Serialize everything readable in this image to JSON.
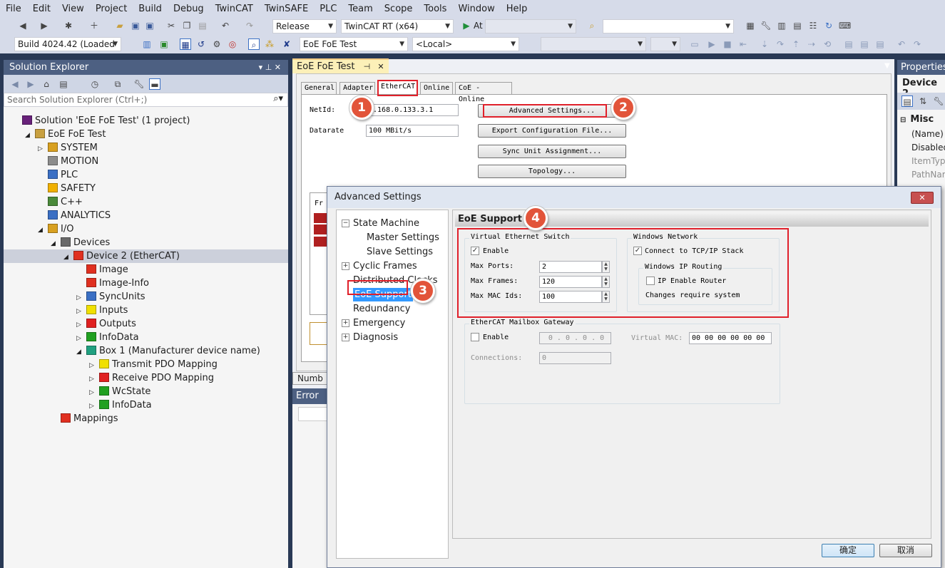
{
  "menu": [
    "File",
    "Edit",
    "View",
    "Project",
    "Build",
    "Debug",
    "TwinCAT",
    "TwinSAFE",
    "PLC",
    "Team",
    "Scope",
    "Tools",
    "Window",
    "Help"
  ],
  "toolbar1": {
    "config": "Release",
    "platform": "TwinCAT RT (x64)",
    "attach": "At"
  },
  "toolbar2": {
    "build": "Build 4024.42 (Loaded",
    "project": "EoE FoE Test",
    "target": "<Local>"
  },
  "solution_explorer": {
    "title": "Solution Explorer",
    "search_placeholder": "Search Solution Explorer (Ctrl+;)",
    "items": [
      {
        "label": "Solution 'EoE FoE Test' (1 project)",
        "color": "#68217a"
      },
      {
        "label": "EoE FoE Test",
        "color": "#c8a040"
      },
      {
        "label": "SYSTEM",
        "color": "#d8a020"
      },
      {
        "label": "MOTION",
        "color": "#8c8c8c"
      },
      {
        "label": "PLC",
        "color": "#3a6fc4"
      },
      {
        "label": "SAFETY",
        "color": "#f0b000"
      },
      {
        "label": "C++",
        "color": "#4a8a3a"
      },
      {
        "label": "ANALYTICS",
        "color": "#3a6fc4"
      },
      {
        "label": "I/O",
        "color": "#d8a020"
      },
      {
        "label": "Devices",
        "color": "#6a6a6a"
      },
      {
        "label": "Device 2 (EtherCAT)",
        "color": "#e03020"
      },
      {
        "label": "Image",
        "color": "#e03020"
      },
      {
        "label": "Image-Info",
        "color": "#e03020"
      },
      {
        "label": "SyncUnits",
        "color": "#3a6fc4"
      },
      {
        "label": "Inputs",
        "color": "#f0e000"
      },
      {
        "label": "Outputs",
        "color": "#e02020"
      },
      {
        "label": "InfoData",
        "color": "#20a020"
      },
      {
        "label": "Box 1 (Manufacturer device name)",
        "color": "#20a080"
      },
      {
        "label": "Transmit PDO Mapping",
        "color": "#f0e000"
      },
      {
        "label": "Receive PDO Mapping",
        "color": "#e02020"
      },
      {
        "label": "WcState",
        "color": "#20a020"
      },
      {
        "label": "InfoData",
        "color": "#20a020"
      },
      {
        "label": "Mappings",
        "color": "#e03020"
      }
    ]
  },
  "doc": {
    "tab_title": "EoE FoE Test",
    "tabs": [
      "General",
      "Adapter",
      "EtherCAT",
      "Online",
      "CoE - Online"
    ],
    "netid_label": "NetId:",
    "netid_value": "2.168.0.133.3.1",
    "datarate_label": "Datarate",
    "datarate_value": "100 MBit/s",
    "buttons": [
      "Advanced Settings...",
      "Export Configuration File...",
      "Sync Unit Assignment...",
      "Topology..."
    ],
    "list_header": "Fr",
    "bottom_tab": "Numb",
    "error_list": "Error Li"
  },
  "properties": {
    "title": "Properties",
    "object": "Device 2",
    "category": "Misc",
    "rows": [
      "(Name)",
      "Disabled",
      "ItemTyp",
      "PathNar"
    ]
  },
  "dialog": {
    "title": "Advanced Settings",
    "close": "✕",
    "tree": [
      {
        "label": "State Machine"
      },
      {
        "label": "Master Settings"
      },
      {
        "label": "Slave Settings"
      },
      {
        "label": "Cyclic Frames"
      },
      {
        "label": "Distributed Clocks"
      },
      {
        "label": "EoE Support"
      },
      {
        "label": "Redundancy"
      },
      {
        "label": "Emergency"
      },
      {
        "label": "Diagnosis"
      }
    ],
    "section_title": "EoE Support",
    "ves": {
      "title": "Virtual Ethernet Switch",
      "enable": "Enable",
      "max_ports_label": "Max Ports:",
      "max_ports": "2",
      "max_frames_label": "Max Frames:",
      "max_frames": "120",
      "max_mac_label": "Max MAC Ids:",
      "max_mac": "100"
    },
    "win": {
      "title": "Windows Network",
      "connect": "Connect to TCP/IP Stack",
      "routing_title": "Windows IP Routing",
      "ip_router": "IP Enable Router",
      "note": "Changes require system"
    },
    "gateway": {
      "title": "EtherCAT Mailbox Gateway",
      "enable": "Enable",
      "ip": "0 . 0 . 0 . 0",
      "vmac_label": "Virtual MAC:",
      "vmac": "00 00 00 00 00 00",
      "conn_label": "Connections:",
      "conn": "0"
    },
    "ok": "确定",
    "cancel": "取消"
  },
  "callouts": [
    "1",
    "2",
    "3",
    "4"
  ]
}
